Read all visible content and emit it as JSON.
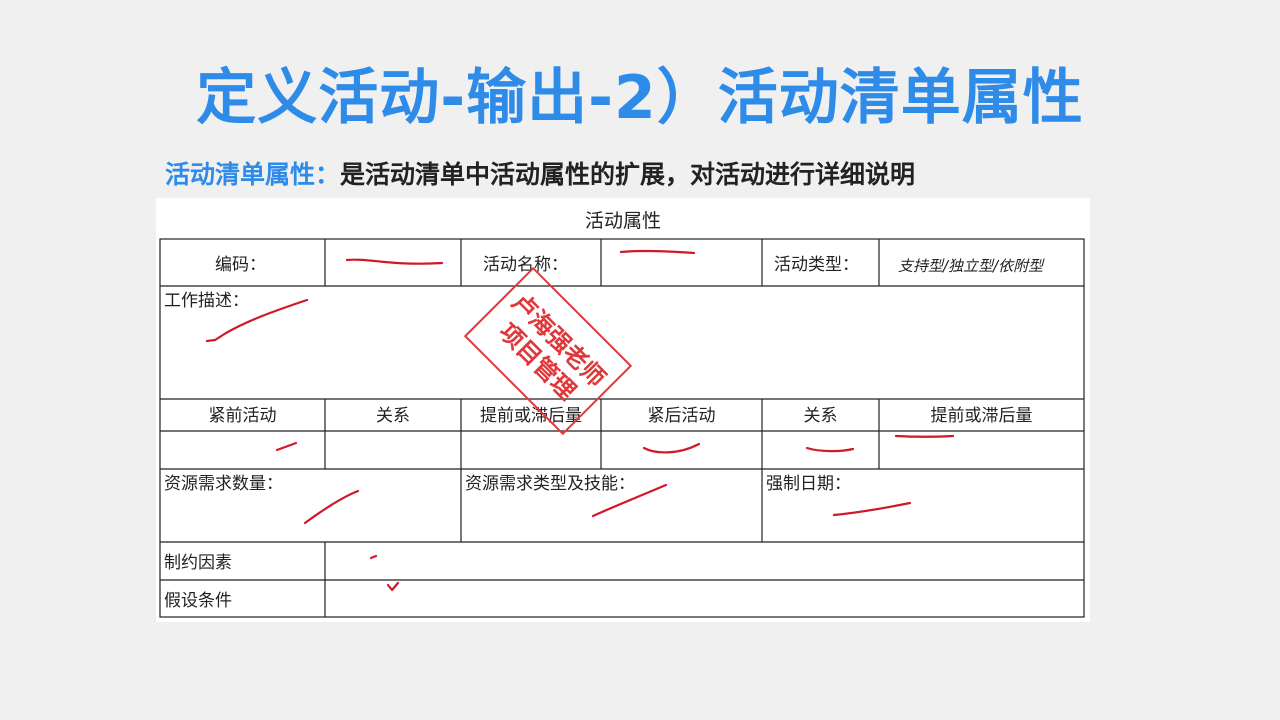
{
  "slide": {
    "title": "定义活动-输出-2）活动清单属性",
    "subtitle_term": "活动清单属性：",
    "subtitle_text": "是活动清单中活动属性的扩展，对活动进行详细说明"
  },
  "table": {
    "caption": "活动属性",
    "row1": {
      "code_label": "编码：",
      "name_label": "活动名称：",
      "type_label": "活动类型：",
      "type_value": "支持型/独立型/依附型"
    },
    "work_desc_label": "工作描述：",
    "header_row": [
      "紧前活动",
      "关系",
      "提前或滞后量",
      "紧后活动",
      "关系",
      "提前或滞后量"
    ],
    "resources": {
      "quantity_label": "资源需求数量：",
      "type_skill_label": "资源需求类型及技能：",
      "date_label": "强制日期："
    },
    "constraints_label": "制约因素",
    "assumptions_label": "假设条件"
  },
  "stamp": {
    "line1": "卢海强老师",
    "line2": "项目管理"
  },
  "colors": {
    "title": "#2e8ce8",
    "ink": "#d0182a",
    "stamp": "#e0383a"
  }
}
